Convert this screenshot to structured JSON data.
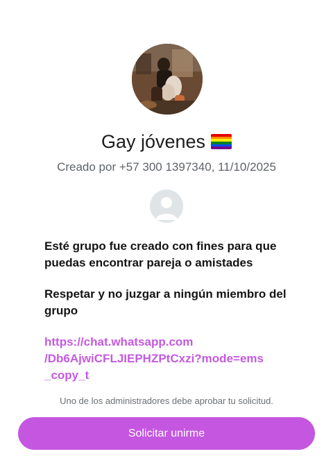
{
  "group": {
    "name": "Gay jóvenes",
    "name_emoji": "rainbow-flag-icon",
    "created_line": "Creado por +57 300 1397340, 11/10/2025",
    "photo": "group-photo"
  },
  "admin": {
    "avatar_icon": "default-avatar-icon"
  },
  "description": {
    "paragraph_1": "Esté grupo fue creado con fines para que puedas encontrar pareja o amistades",
    "paragraph_2": "Respetar y no juzgar a ningún miembro del grupo",
    "link": "https://chat.whatsapp.com\n/Db6AjwiCFLJIEPHZPtCxzi?mode=ems\n_copy_t"
  },
  "approval_note": "Uno de los administradores debe aprobar tu solicitud.",
  "join_button_label": "Solicitar unirme",
  "colors": {
    "accent": "#c456e0",
    "link": "#c45ae0",
    "muted_text": "#5f6368",
    "avatar_bg": "#dfe5e7"
  }
}
